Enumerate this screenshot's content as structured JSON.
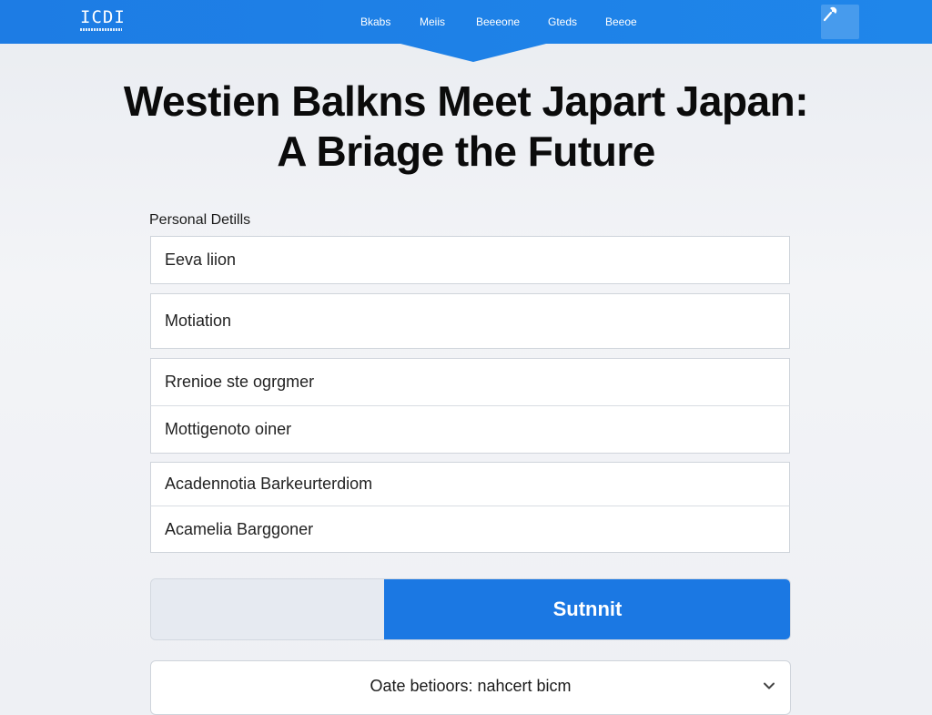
{
  "header": {
    "logo": {
      "mark": "ICDI"
    },
    "nav": [
      "Bkabs",
      "Meiis",
      "Beeeone",
      "Gteds",
      "Beeoe"
    ],
    "tool_icon": "edit-pen-icon"
  },
  "hero": {
    "title_line1": "Westien Balkns Meet Japart Japan:",
    "title_line2": "A Briage the Future"
  },
  "form": {
    "section_label": "Personal Detills",
    "fields": [
      "Eeva liion",
      "Motiation",
      "Rrenioe ste ogrgmer",
      "Mottigenoto oiner",
      "Acadennotia Barkeurterdiom",
      "Acamelia Barggoner"
    ],
    "submit_label": "Sutnnit",
    "select_value": "Oate betioors: nahcert bicm"
  },
  "colors": {
    "brand_blue": "#1b78e3",
    "header_blue": "#1f7fe6",
    "page_bg": "#eef0f4"
  }
}
